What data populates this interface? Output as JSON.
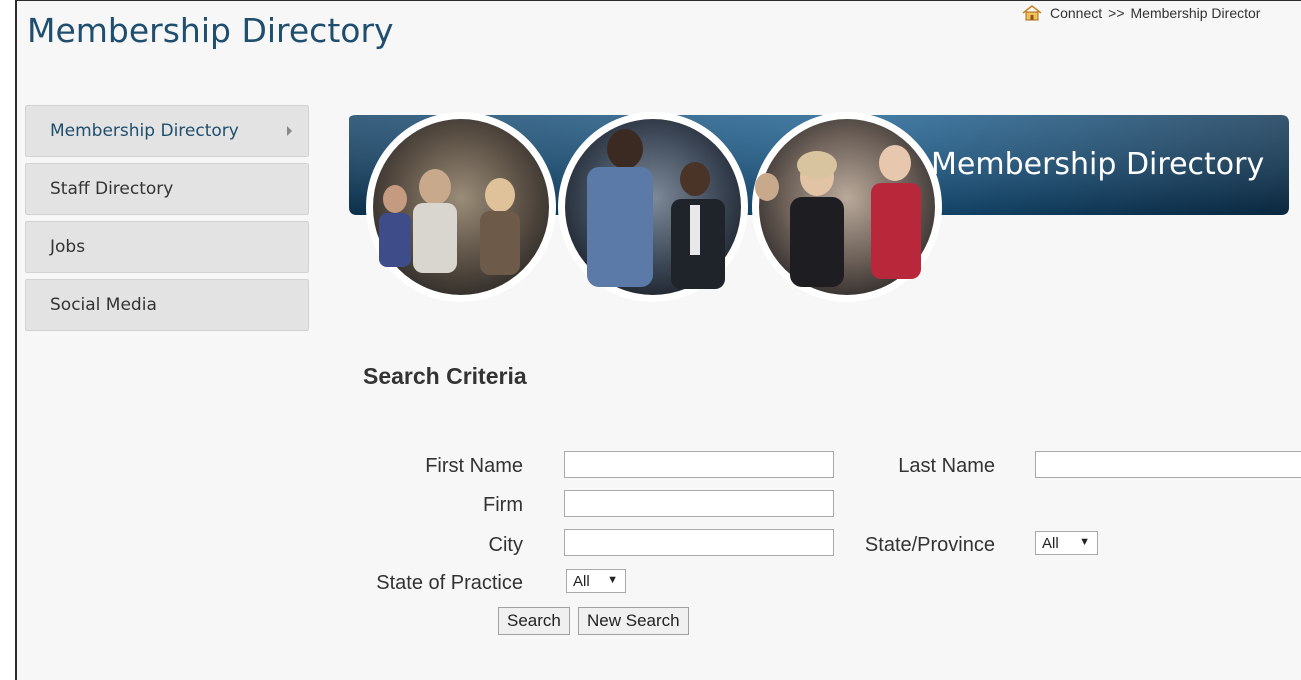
{
  "header": {
    "page_title": "Membership Directory",
    "breadcrumb": {
      "home_icon": "home-icon",
      "link": "Connect",
      "separator": ">>",
      "current": "Membership Director"
    }
  },
  "sidebar": {
    "items": [
      {
        "label": "Membership Directory",
        "active": true
      },
      {
        "label": "Staff Directory"
      },
      {
        "label": "Jobs"
      },
      {
        "label": "Social Media"
      }
    ]
  },
  "banner": {
    "title": "Membership  Directory",
    "accent": "#1f5f8f"
  },
  "search": {
    "heading": "Search Criteria",
    "first_name_label": "First Name",
    "last_name_label": "Last Name",
    "firm_label": "Firm",
    "city_label": "City",
    "state_province_label": "State/Province",
    "state_province_value": "All",
    "state_practice_label": "State of Practice",
    "state_practice_value": "All",
    "first_name_value": "",
    "last_name_value": "",
    "firm_value": "",
    "city_value": "",
    "search_button": "Search",
    "new_search_button": "New Search"
  }
}
